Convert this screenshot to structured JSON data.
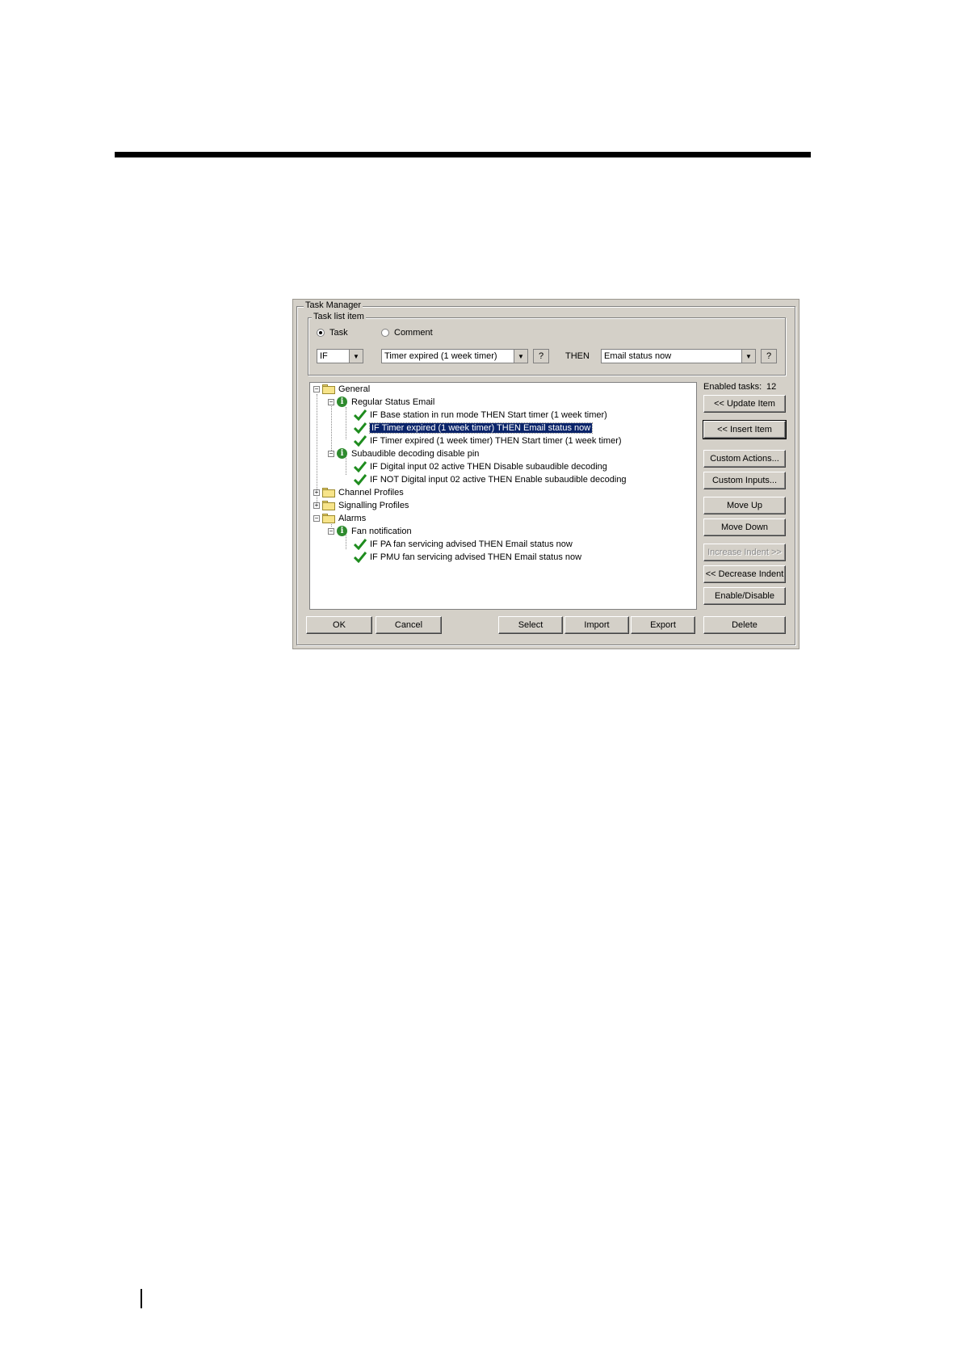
{
  "dialog": {
    "title": "Task Manager",
    "task_list_item": {
      "label": "Task list item",
      "radio_task": "Task",
      "radio_comment": "Comment",
      "if_combo": "IF",
      "condition_combo": "Timer expired (1 week timer)",
      "help_label": "?",
      "then_label": "THEN",
      "action_combo": "Email status now"
    },
    "tree": {
      "general": "General",
      "regular_status_email": "Regular Status Email",
      "task1": "IF Base station in run mode THEN Start timer (1 week timer)",
      "task2": "IF Timer expired (1 week timer) THEN Email status now",
      "task3": "IF Timer expired (1 week timer) THEN Start timer (1 week timer)",
      "subaudible": "Subaudible decoding disable pin",
      "task4": "IF Digital input 02 active THEN Disable subaudible decoding",
      "task5": "IF NOT Digital input 02 active THEN Enable subaudible decoding",
      "channel_profiles": "Channel Profiles",
      "signalling_profiles": "Signalling Profiles",
      "alarms": "Alarms",
      "fan_notification": "Fan notification",
      "task6": "IF PA fan servicing advised THEN Email status now",
      "task7": "IF PMU fan servicing advised THEN Email status now"
    },
    "side": {
      "enabled_label": "Enabled tasks:",
      "enabled_count": "12",
      "update_item": "<<  Update Item",
      "insert_item": "<< Insert Item",
      "custom_actions": "Custom Actions...",
      "custom_inputs": "Custom Inputs...",
      "move_up": "Move Up",
      "move_down": "Move Down",
      "increase_indent": "Increase Indent >>",
      "decrease_indent": "<< Decrease Indent",
      "enable_disable": "Enable/Disable"
    },
    "bottom": {
      "ok": "OK",
      "cancel": "Cancel",
      "select": "Select",
      "import": "Import",
      "export": "Export",
      "delete": "Delete"
    },
    "icons": {
      "folder": "folder-icon",
      "info": "info-icon",
      "check": "checkmark-icon",
      "dropdown": "chevron-down-icon"
    }
  }
}
